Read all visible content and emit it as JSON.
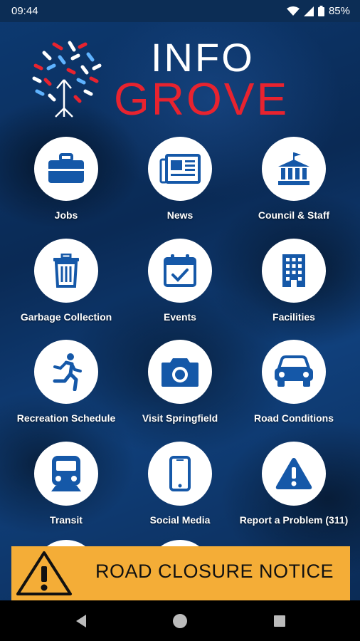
{
  "status": {
    "time": "09:44",
    "battery": "85%"
  },
  "app": {
    "logo_line1": "INFO",
    "logo_line2": "GROVE"
  },
  "tiles": [
    {
      "label": "Jobs",
      "icon": "briefcase-icon"
    },
    {
      "label": "News",
      "icon": "newspaper-icon"
    },
    {
      "label": "Council & Staff",
      "icon": "city-hall-icon"
    },
    {
      "label": "Garbage Collection",
      "icon": "trash-icon"
    },
    {
      "label": "Events",
      "icon": "calendar-check-icon"
    },
    {
      "label": "Facilities",
      "icon": "building-icon"
    },
    {
      "label": "Recreation Schedule",
      "icon": "running-person-icon"
    },
    {
      "label": "Visit Springfield",
      "icon": "camera-icon"
    },
    {
      "label": "Road Conditions",
      "icon": "car-icon"
    },
    {
      "label": "Transit",
      "icon": "train-icon"
    },
    {
      "label": "Social Media",
      "icon": "smartphone-icon"
    },
    {
      "label": "Report a Problem (311)",
      "icon": "warning-icon"
    }
  ],
  "banner": {
    "text": "ROAD CLOSURE NOTICE",
    "color": "#f4ad37"
  },
  "colors": {
    "icon_blue": "#1558a8",
    "brand_red": "#e8232f"
  }
}
